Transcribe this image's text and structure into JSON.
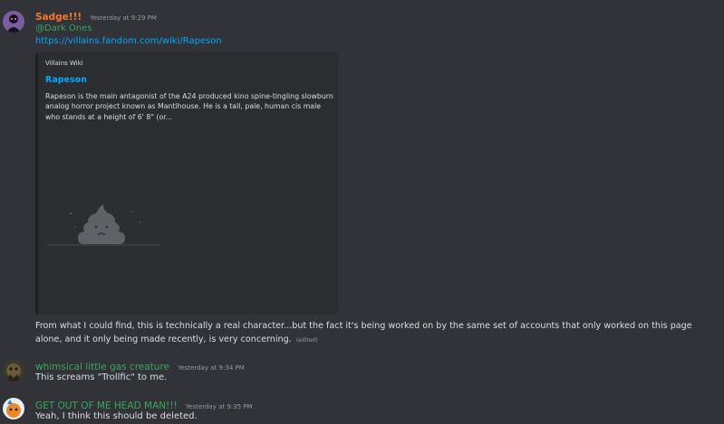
{
  "messages": [
    {
      "author": "Sadge!!!",
      "author_color": "#f57731",
      "timestamp": "Yesterday at 9:29 PM",
      "mention": "@Dark Ones",
      "link": "https://villains.fandom.com/wiki/Rapeson",
      "embed": {
        "provider": "Villains Wiki",
        "title": "Rapeson",
        "description": "Rapeson is the main antagonist of the A24 produced kino spine-tingling slowburn analog horror project known as Mantihouse. He is a tall, pale, human cis male who stands at a height of 6' 8\" (or...",
        "image_icon": "sad-poop-placeholder-icon"
      },
      "body": "From what I could find, this is technically a real character...but the fact it's being worked on by the same set of accounts that only worked on this page alone, and it only being made recently, is very concerning.",
      "edited_label": "(edited)"
    },
    {
      "author": "whimsical little gas creature",
      "author_color": "#3ba55c",
      "timestamp": "Yesterday at 9:34 PM",
      "body": "This screams \"Trollfic\" to me."
    },
    {
      "author": "GET OUT OF ME HEAD MAN!!!",
      "author_color": "#3ba55c",
      "timestamp": "Yesterday at 9:35 PM",
      "body": "Yeah, I think this should be deleted."
    }
  ]
}
